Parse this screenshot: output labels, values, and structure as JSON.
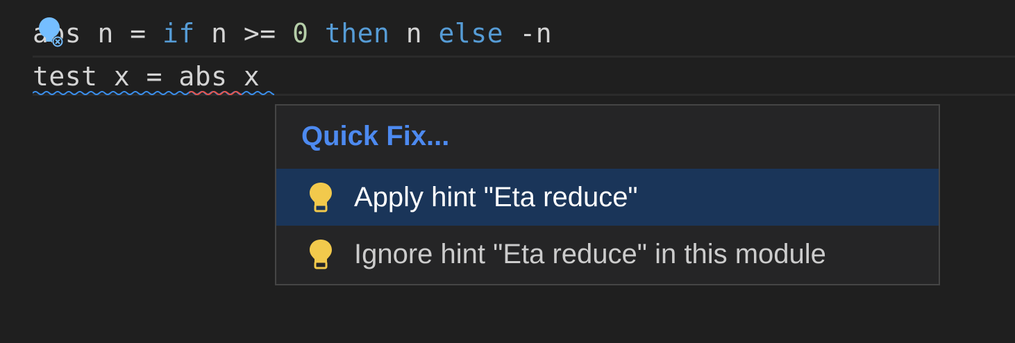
{
  "editor": {
    "lines": [
      {
        "tokens": [
          {
            "text": "abs n = ",
            "kind": "plain"
          },
          {
            "text": "if",
            "kind": "keyword"
          },
          {
            "text": " n >= ",
            "kind": "plain"
          },
          {
            "text": "0",
            "kind": "number"
          },
          {
            "text": " ",
            "kind": "plain"
          },
          {
            "text": "then",
            "kind": "keyword"
          },
          {
            "text": " n ",
            "kind": "plain"
          },
          {
            "text": "else",
            "kind": "keyword"
          },
          {
            "text": " -n",
            "kind": "plain"
          }
        ]
      },
      {
        "tokens": [
          {
            "text": "test x = abs x",
            "kind": "plain"
          }
        ]
      }
    ],
    "diagnostics": {
      "warning_color": "#3b8eea",
      "error_color": "#e5534b"
    },
    "colors": {
      "background": "#1f1f1f",
      "keyword": "#569cd6",
      "number": "#b5cea8",
      "text": "#d4d4d4"
    }
  },
  "quick_fix": {
    "title": "Quick Fix...",
    "title_color": "#4d8af0",
    "items": [
      {
        "label": "Apply hint \"Eta reduce\"",
        "icon": "lightbulb-icon",
        "selected": true
      },
      {
        "label": "Ignore hint \"Eta reduce\" in this module",
        "icon": "lightbulb-icon",
        "selected": false
      }
    ],
    "selected_bg": "#1a3559",
    "icon_color": "#f2c94c"
  }
}
